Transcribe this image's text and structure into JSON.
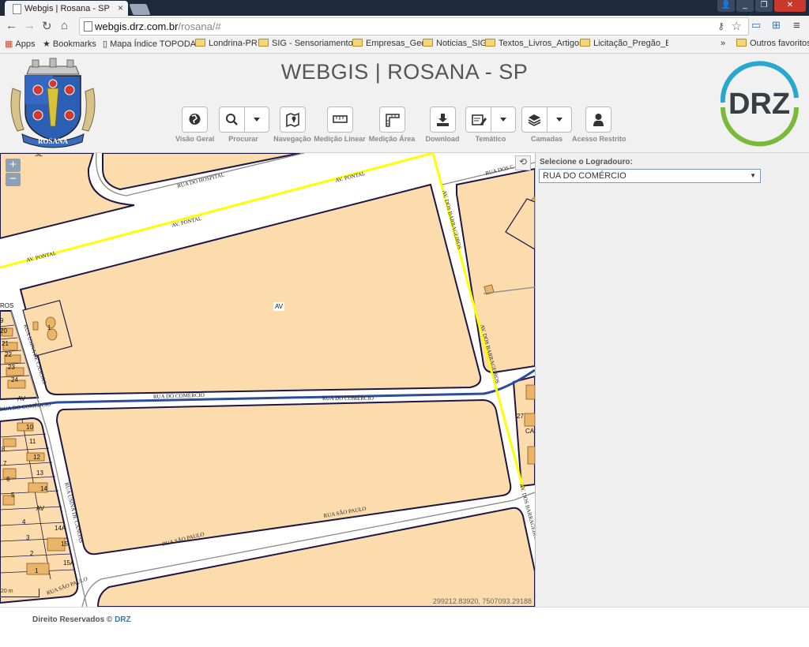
{
  "browser": {
    "tab_title": "Webgis | Rosana - SP",
    "tab_close": "×",
    "url_host": "webgis.drz.com.br",
    "url_path": "/rosana/#",
    "bookmarks": [
      {
        "label": "Apps",
        "icon": "apps-grid-icon"
      },
      {
        "label": "Bookmarks",
        "icon": "star-icon"
      },
      {
        "label": "Mapa Índice TOPODA",
        "icon": "page-icon"
      },
      {
        "label": "Londrina-PR",
        "icon": "folder-icon"
      },
      {
        "label": "SIG - Sensoriamento",
        "icon": "folder-icon"
      },
      {
        "label": "Empresas_Geo",
        "icon": "folder-icon"
      },
      {
        "label": "Noticias_SIG",
        "icon": "folder-icon"
      },
      {
        "label": "Textos_Livros_Artigos",
        "icon": "folder-icon"
      },
      {
        "label": "Licitação_Pregão_Elet",
        "icon": "folder-icon"
      }
    ],
    "overflow": "»",
    "other_bookmarks": "Outros favoritos"
  },
  "header": {
    "title": "WEBGIS | ROSANA - SP",
    "coat_text": "ROSANA",
    "logo_text": "DRZ",
    "tools": [
      {
        "label": "Visão Geral",
        "icon": "globe-icon"
      },
      {
        "label": "Procurar",
        "icon": "search-icon"
      },
      {
        "label": "Navegação",
        "icon": "map-pin-icon"
      },
      {
        "label": "Medição Linear",
        "icon": "ruler-icon"
      },
      {
        "label": "Medição Área",
        "icon": "area-ruler-icon"
      },
      {
        "label": "Download",
        "icon": "download-icon"
      },
      {
        "label": "Temático",
        "icon": "thematic-icon"
      },
      {
        "label": "Camadas",
        "icon": "layers-icon"
      },
      {
        "label": "Acesso Restrito",
        "icon": "user-icon"
      }
    ]
  },
  "map": {
    "zoom_in": "+",
    "zoom_out": "−",
    "coords": "299212.83920, 7507093.29188",
    "scale": "20 m",
    "street_labels": [
      "RUA DO HOSPITAL",
      "AV. PONTAL",
      "AV. PONTAL",
      "AV. PONTAL",
      "AV. DOS BARRAGEIROS",
      "AV. DOS BARRAGEIROS",
      "RUA DOS C",
      "RUA DO COMÉRCIO",
      "RUA DO COMÉRCIO",
      "RUA DO COMÉRCIO",
      "RUA SÃO PAULO",
      "RUA SÃO PAULO",
      "RUA SÃO PAULO",
      "RUA USINA DE CANOAS",
      "RUA USINA DE CANOAS",
      "AV. DOS BARRAGEIROS"
    ],
    "lot_numbers": [
      "9",
      "20",
      "21",
      "22",
      "23",
      "24",
      "10",
      "11",
      "12",
      "13",
      "14",
      "14A",
      "15",
      "15A",
      "8",
      "7",
      "6",
      "5",
      "4",
      "3",
      "2",
      "1",
      "1",
      "27"
    ],
    "other_labels": [
      "AV",
      "AV",
      "AV",
      "ROS",
      "SL",
      "CA"
    ]
  },
  "sidebar": {
    "label": "Selecione o Logradouro:",
    "selected": "RUA DO COMÉRCIO"
  },
  "footer": {
    "text": "Direito Reservados ©",
    "link": "DRZ"
  },
  "colors": {
    "lot_fill": "#fcdcad",
    "lot_stroke": "#1d1746",
    "street_line": "#ffff00",
    "highlight_street": "#2d4c9c",
    "sidebar_bg": "#f0f0f0"
  }
}
